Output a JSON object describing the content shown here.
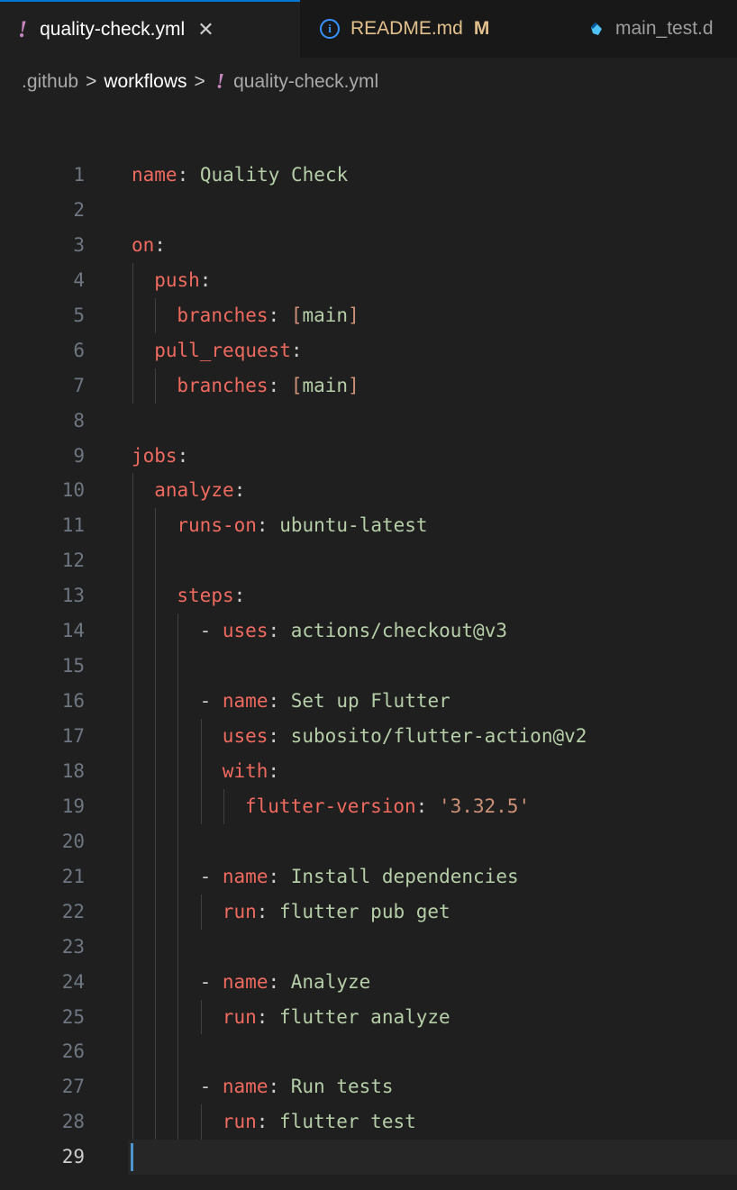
{
  "tabs": [
    {
      "label": "quality-check.yml",
      "close": "✕",
      "active": true
    },
    {
      "label": "README.md",
      "status": "M"
    },
    {
      "label": "main_test.d"
    }
  ],
  "breadcrumb": [
    ".github",
    "workflows",
    "quality-check.yml"
  ],
  "lines": [
    {
      "n": "1",
      "indent": 0,
      "tokens": [
        [
          "k",
          "name"
        ],
        [
          "p",
          ": "
        ],
        [
          "v",
          "Quality Check"
        ]
      ]
    },
    {
      "n": "2",
      "indent": 0,
      "tokens": []
    },
    {
      "n": "3",
      "indent": 0,
      "tokens": [
        [
          "k",
          "on"
        ],
        [
          "p",
          ":"
        ]
      ]
    },
    {
      "n": "4",
      "indent": 1,
      "tokens": [
        [
          "k",
          "push"
        ],
        [
          "p",
          ":"
        ]
      ]
    },
    {
      "n": "5",
      "indent": 2,
      "tokens": [
        [
          "k",
          "branches"
        ],
        [
          "p",
          ": "
        ],
        [
          "s",
          "["
        ],
        [
          "v",
          "main"
        ],
        [
          "s",
          "]"
        ]
      ]
    },
    {
      "n": "6",
      "indent": 1,
      "tokens": [
        [
          "k",
          "pull_request"
        ],
        [
          "p",
          ":"
        ]
      ]
    },
    {
      "n": "7",
      "indent": 2,
      "tokens": [
        [
          "k",
          "branches"
        ],
        [
          "p",
          ": "
        ],
        [
          "s",
          "["
        ],
        [
          "v",
          "main"
        ],
        [
          "s",
          "]"
        ]
      ]
    },
    {
      "n": "8",
      "indent": 0,
      "tokens": []
    },
    {
      "n": "9",
      "indent": 0,
      "tokens": [
        [
          "k",
          "jobs"
        ],
        [
          "p",
          ":"
        ]
      ]
    },
    {
      "n": "10",
      "indent": 1,
      "tokens": [
        [
          "k",
          "analyze"
        ],
        [
          "p",
          ":"
        ]
      ]
    },
    {
      "n": "11",
      "indent": 2,
      "tokens": [
        [
          "k",
          "runs-on"
        ],
        [
          "p",
          ": "
        ],
        [
          "v",
          "ubuntu-latest"
        ]
      ]
    },
    {
      "n": "12",
      "indent": 0,
      "tokens": []
    },
    {
      "n": "13",
      "indent": 2,
      "tokens": [
        [
          "k",
          "steps"
        ],
        [
          "p",
          ":"
        ]
      ]
    },
    {
      "n": "14",
      "indent": 3,
      "tokens": [
        [
          "p",
          "- "
        ],
        [
          "k",
          "uses"
        ],
        [
          "p",
          ": "
        ],
        [
          "v",
          "actions/checkout@v3"
        ]
      ]
    },
    {
      "n": "15",
      "indent": 0,
      "tokens": []
    },
    {
      "n": "16",
      "indent": 3,
      "tokens": [
        [
          "p",
          "- "
        ],
        [
          "k",
          "name"
        ],
        [
          "p",
          ": "
        ],
        [
          "v",
          "Set up Flutter"
        ]
      ]
    },
    {
      "n": "17",
      "indent": 4,
      "tokens": [
        [
          "k",
          "uses"
        ],
        [
          "p",
          ": "
        ],
        [
          "v",
          "subosito/flutter-action@v2"
        ]
      ]
    },
    {
      "n": "18",
      "indent": 4,
      "tokens": [
        [
          "k",
          "with"
        ],
        [
          "p",
          ":"
        ]
      ]
    },
    {
      "n": "19",
      "indent": 5,
      "tokens": [
        [
          "k",
          "flutter-version"
        ],
        [
          "p",
          ": "
        ],
        [
          "sq",
          "'3.32.5'"
        ]
      ]
    },
    {
      "n": "20",
      "indent": 0,
      "tokens": []
    },
    {
      "n": "21",
      "indent": 3,
      "tokens": [
        [
          "p",
          "- "
        ],
        [
          "k",
          "name"
        ],
        [
          "p",
          ": "
        ],
        [
          "v",
          "Install dependencies"
        ]
      ]
    },
    {
      "n": "22",
      "indent": 4,
      "tokens": [
        [
          "k",
          "run"
        ],
        [
          "p",
          ": "
        ],
        [
          "v",
          "flutter pub get"
        ]
      ]
    },
    {
      "n": "23",
      "indent": 0,
      "tokens": []
    },
    {
      "n": "24",
      "indent": 3,
      "tokens": [
        [
          "p",
          "- "
        ],
        [
          "k",
          "name"
        ],
        [
          "p",
          ": "
        ],
        [
          "v",
          "Analyze"
        ]
      ]
    },
    {
      "n": "25",
      "indent": 4,
      "tokens": [
        [
          "k",
          "run"
        ],
        [
          "p",
          ": "
        ],
        [
          "v",
          "flutter analyze"
        ]
      ]
    },
    {
      "n": "26",
      "indent": 0,
      "tokens": []
    },
    {
      "n": "27",
      "indent": 3,
      "tokens": [
        [
          "p",
          "- "
        ],
        [
          "k",
          "name"
        ],
        [
          "p",
          ": "
        ],
        [
          "v",
          "Run tests"
        ]
      ]
    },
    {
      "n": "28",
      "indent": 4,
      "tokens": [
        [
          "k",
          "run"
        ],
        [
          "p",
          ": "
        ],
        [
          "v",
          "flutter test"
        ]
      ]
    },
    {
      "n": "29",
      "indent": 0,
      "tokens": [],
      "current": true
    }
  ]
}
